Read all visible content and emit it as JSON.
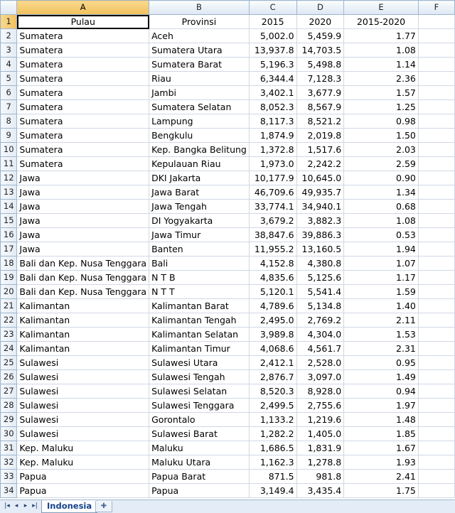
{
  "columns": [
    "A",
    "B",
    "C",
    "D",
    "E",
    "F"
  ],
  "header": {
    "pulau": "Pulau",
    "provinsi": "Provinsi",
    "y2015": "2015",
    "y2020": "2020",
    "change": "2015-2020"
  },
  "rows": [
    {
      "n": "2",
      "pulau": "Sumatera",
      "provinsi": "Aceh",
      "y2015": "5,002.0",
      "y2020": "5,459.9",
      "change": "1.77"
    },
    {
      "n": "3",
      "pulau": "Sumatera",
      "provinsi": "Sumatera Utara",
      "y2015": "13,937.8",
      "y2020": "14,703.5",
      "change": "1.08"
    },
    {
      "n": "4",
      "pulau": "Sumatera",
      "provinsi": "Sumatera Barat",
      "y2015": "5,196.3",
      "y2020": "5,498.8",
      "change": "1.14"
    },
    {
      "n": "5",
      "pulau": "Sumatera",
      "provinsi": "Riau",
      "y2015": "6,344.4",
      "y2020": "7,128.3",
      "change": "2.36"
    },
    {
      "n": "6",
      "pulau": "Sumatera",
      "provinsi": "Jambi",
      "y2015": "3,402.1",
      "y2020": "3,677.9",
      "change": "1.57"
    },
    {
      "n": "7",
      "pulau": "Sumatera",
      "provinsi": "Sumatera Selatan",
      "y2015": "8,052.3",
      "y2020": "8,567.9",
      "change": "1.25"
    },
    {
      "n": "8",
      "pulau": "Sumatera",
      "provinsi": "Lampung",
      "y2015": "8,117.3",
      "y2020": "8,521.2",
      "change": "0.98"
    },
    {
      "n": "9",
      "pulau": "Sumatera",
      "provinsi": "Bengkulu",
      "y2015": "1,874.9",
      "y2020": "2,019.8",
      "change": "1.50"
    },
    {
      "n": "10",
      "pulau": "Sumatera",
      "provinsi": "Kep. Bangka Belitung",
      "y2015": "1,372.8",
      "y2020": "1,517.6",
      "change": "2.03"
    },
    {
      "n": "11",
      "pulau": "Sumatera",
      "provinsi": "Kepulauan Riau",
      "y2015": "1,973.0",
      "y2020": "2,242.2",
      "change": "2.59"
    },
    {
      "n": "12",
      "pulau": "Jawa",
      "provinsi": "DKI Jakarta",
      "y2015": "10,177.9",
      "y2020": "10,645.0",
      "change": "0.90"
    },
    {
      "n": "13",
      "pulau": "Jawa",
      "provinsi": "Jawa Barat",
      "y2015": "46,709.6",
      "y2020": "49,935.7",
      "change": "1.34"
    },
    {
      "n": "14",
      "pulau": "Jawa",
      "provinsi": "Jawa Tengah",
      "y2015": "33,774.1",
      "y2020": "34,940.1",
      "change": "0.68"
    },
    {
      "n": "15",
      "pulau": "Jawa",
      "provinsi": "DI Yogyakarta",
      "y2015": "3,679.2",
      "y2020": "3,882.3",
      "change": "1.08"
    },
    {
      "n": "16",
      "pulau": "Jawa",
      "provinsi": "Jawa Timur",
      "y2015": "38,847.6",
      "y2020": "39,886.3",
      "change": "0.53"
    },
    {
      "n": "17",
      "pulau": "Jawa",
      "provinsi": "Banten",
      "y2015": "11,955.2",
      "y2020": "13,160.5",
      "change": "1.94"
    },
    {
      "n": "18",
      "pulau": "Bali dan Kep. Nusa Tenggara",
      "provinsi": "Bali",
      "y2015": "4,152.8",
      "y2020": "4,380.8",
      "change": "1.07"
    },
    {
      "n": "19",
      "pulau": "Bali dan Kep. Nusa Tenggara",
      "provinsi": "N T B",
      "y2015": "4,835.6",
      "y2020": "5,125.6",
      "change": "1.17"
    },
    {
      "n": "20",
      "pulau": "Bali dan Kep. Nusa Tenggara",
      "provinsi": "N T T",
      "y2015": "5,120.1",
      "y2020": "5,541.4",
      "change": "1.59"
    },
    {
      "n": "21",
      "pulau": "Kalimantan",
      "provinsi": "Kalimantan Barat",
      "y2015": "4,789.6",
      "y2020": "5,134.8",
      "change": "1.40"
    },
    {
      "n": "22",
      "pulau": "Kalimantan",
      "provinsi": "Kalimantan Tengah",
      "y2015": "2,495.0",
      "y2020": "2,769.2",
      "change": "2.11"
    },
    {
      "n": "23",
      "pulau": "Kalimantan",
      "provinsi": "Kalimantan Selatan",
      "y2015": "3,989.8",
      "y2020": "4,304.0",
      "change": "1.53"
    },
    {
      "n": "24",
      "pulau": "Kalimantan",
      "provinsi": "Kalimantan Timur",
      "y2015": "4,068.6",
      "y2020": "4,561.7",
      "change": "2.31"
    },
    {
      "n": "25",
      "pulau": "Sulawesi",
      "provinsi": "Sulawesi Utara",
      "y2015": "2,412.1",
      "y2020": "2,528.0",
      "change": "0.95"
    },
    {
      "n": "26",
      "pulau": "Sulawesi",
      "provinsi": "Sulawesi Tengah",
      "y2015": "2,876.7",
      "y2020": "3,097.0",
      "change": "1.49"
    },
    {
      "n": "27",
      "pulau": "Sulawesi",
      "provinsi": "Sulawesi Selatan",
      "y2015": "8,520.3",
      "y2020": "8,928.0",
      "change": "0.94"
    },
    {
      "n": "28",
      "pulau": "Sulawesi",
      "provinsi": "Sulawesi Tenggara",
      "y2015": "2,499.5",
      "y2020": "2,755.6",
      "change": "1.97"
    },
    {
      "n": "29",
      "pulau": "Sulawesi",
      "provinsi": "Gorontalo",
      "y2015": "1,133.2",
      "y2020": "1,219.6",
      "change": "1.48"
    },
    {
      "n": "30",
      "pulau": "Sulawesi",
      "provinsi": "Sulawesi Barat",
      "y2015": "1,282.2",
      "y2020": "1,405.0",
      "change": "1.85"
    },
    {
      "n": "31",
      "pulau": "Kep. Maluku",
      "provinsi": "Maluku",
      "y2015": "1,686.5",
      "y2020": "1,831.9",
      "change": "1.67"
    },
    {
      "n": "32",
      "pulau": "Kep. Maluku",
      "provinsi": "Maluku Utara",
      "y2015": "1,162.3",
      "y2020": "1,278.8",
      "change": "1.93"
    },
    {
      "n": "33",
      "pulau": "Papua",
      "provinsi": "Papua Barat",
      "y2015": "871.5",
      "y2020": "981.8",
      "change": "2.41"
    },
    {
      "n": "34",
      "pulau": "Papua",
      "provinsi": "Papua",
      "y2015": "3,149.4",
      "y2020": "3,435.4",
      "change": "1.75"
    }
  ],
  "sheet_tab": "Indonesia",
  "icons": {
    "nav_first": "first-sheet-icon",
    "nav_prev": "prev-sheet-icon",
    "nav_next": "next-sheet-icon",
    "nav_last": "last-sheet-icon",
    "insert": "insert-sheet-icon"
  },
  "colors": {
    "header_bg": "#dde7f3",
    "selected_header": "#f1c05c",
    "gridline": "#d0d7e5"
  }
}
